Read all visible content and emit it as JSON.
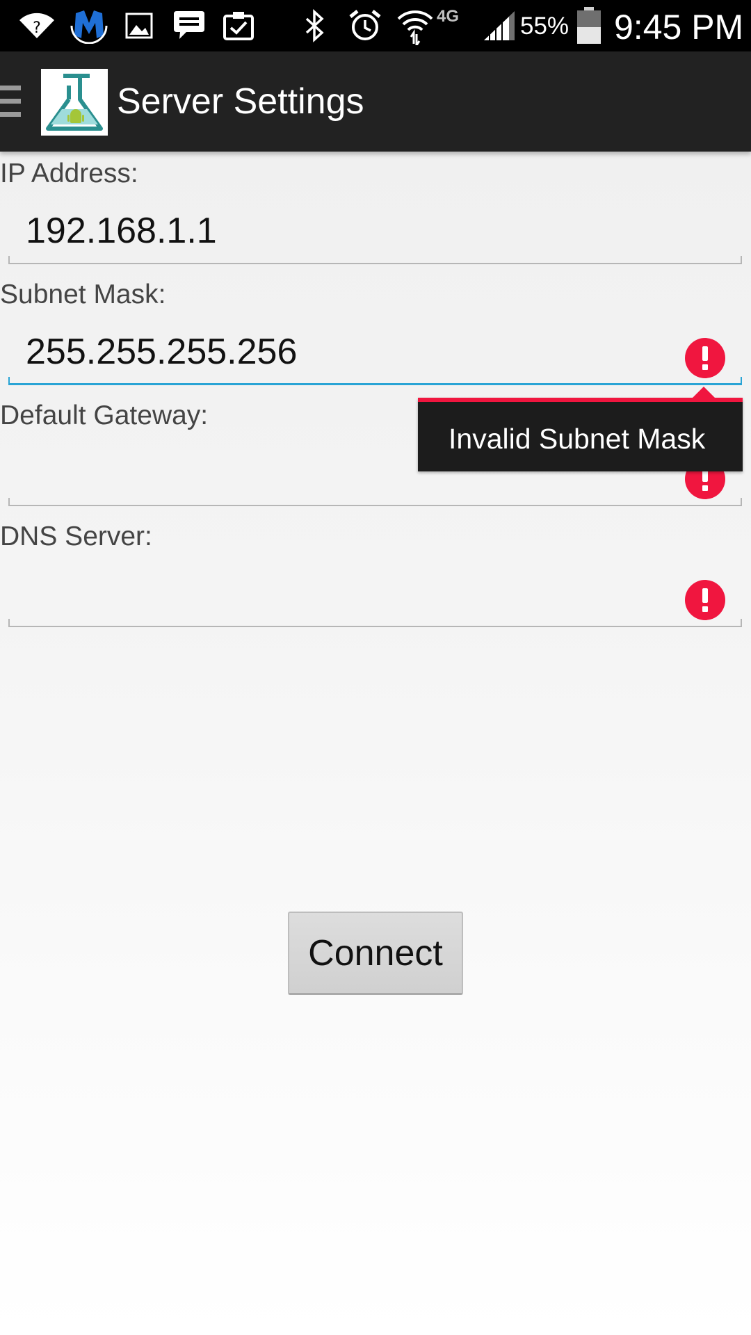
{
  "status_bar": {
    "battery_percent": "55%",
    "time": "9:45 PM",
    "network_label": "4G",
    "icons": [
      "wifi-question-icon",
      "malwarebytes-icon",
      "gallery-icon",
      "message-icon",
      "clipboard-check-icon",
      "bluetooth-icon",
      "alarm-icon",
      "wifi-icon",
      "lte-icon",
      "signal-icon",
      "battery-icon"
    ]
  },
  "action_bar": {
    "title": "Server Settings",
    "icons": [
      "menu-icon",
      "app-flask-android-icon"
    ]
  },
  "form": {
    "ip_address": {
      "label": "IP Address:",
      "value": "192.168.1.1"
    },
    "subnet_mask": {
      "label": "Subnet Mask:",
      "value": "255.255.255.256",
      "error": "Invalid Subnet Mask"
    },
    "default_gateway": {
      "label": "Default Gateway:",
      "value": ""
    },
    "dns_server": {
      "label": "DNS Server:",
      "value": ""
    }
  },
  "connect_button": {
    "label": "Connect"
  },
  "colors": {
    "accent": "#2aa4d5",
    "error": "#f0163f",
    "action_bar": "#222222",
    "status_bar": "#000000"
  }
}
